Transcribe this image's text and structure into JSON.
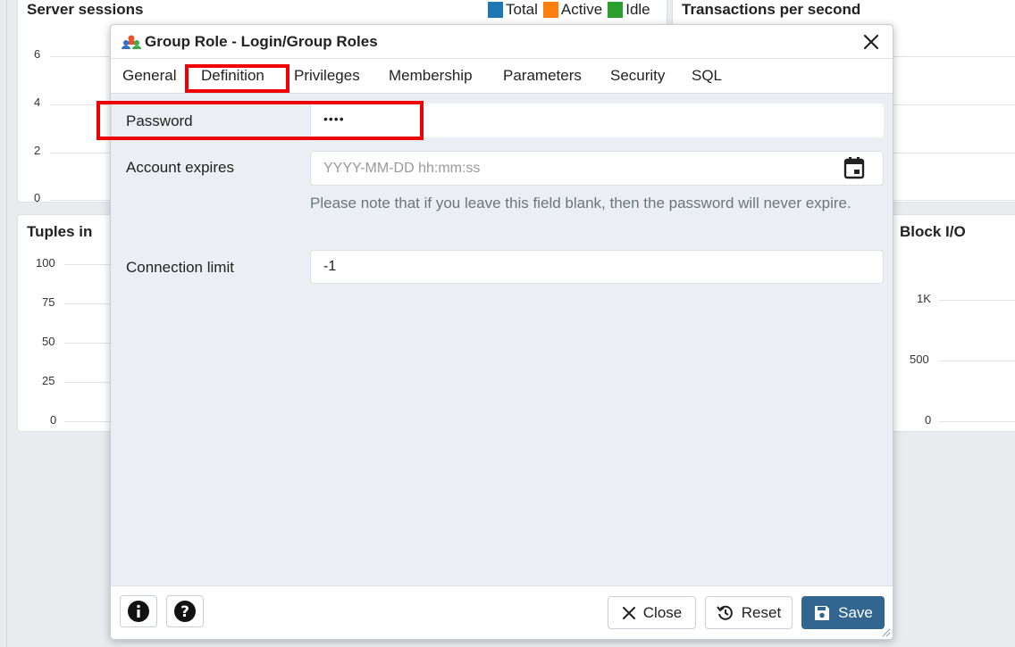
{
  "dashboard": {
    "sessions": {
      "title": "Server sessions",
      "ticks": [
        "6",
        "4",
        "2",
        "0"
      ],
      "legend": [
        {
          "label": "Total",
          "color": "#1f77b4"
        },
        {
          "label": "Active",
          "color": "#ff7f0e"
        },
        {
          "label": "Idle",
          "color": "#2ca02c"
        }
      ]
    },
    "tps": {
      "title": "Transactions per second"
    },
    "tuples": {
      "title": "Tuples in",
      "ticks": [
        "100",
        "75",
        "50",
        "25",
        "0"
      ]
    },
    "blockio": {
      "title": "Block I/O",
      "ticks": [
        "1K",
        "500",
        "0"
      ]
    }
  },
  "dialog": {
    "title": "Group Role - Login/Group Roles",
    "icon": "group-role-icon",
    "tabs": [
      "General",
      "Definition",
      "Privileges",
      "Membership",
      "Parameters",
      "Security",
      "SQL"
    ],
    "active_tab": "Definition",
    "fields": {
      "password": {
        "label": "Password",
        "value": "••••"
      },
      "account_expires": {
        "label": "Account expires",
        "placeholder": "YYYY-MM-DD hh:mm:ss",
        "help": "Please note that if you leave this field blank, then the password will never expire."
      },
      "connection_limit": {
        "label": "Connection limit",
        "value": "-1"
      }
    },
    "footer": {
      "close_label": "Close",
      "reset_label": "Reset",
      "save_label": "Save"
    }
  },
  "colors": {
    "accent": "#326690",
    "highlight": "#e00000"
  }
}
